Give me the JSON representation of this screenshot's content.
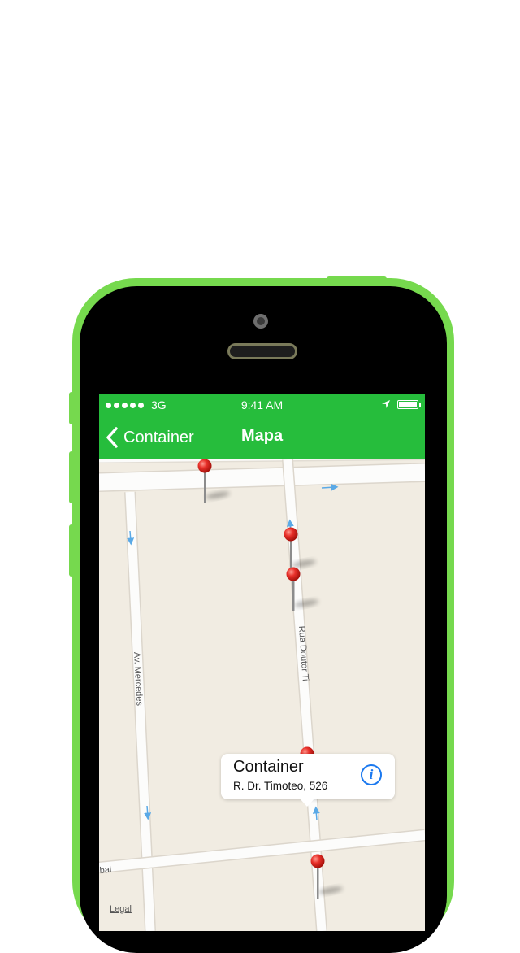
{
  "status_bar": {
    "carrier": "3G",
    "time": "9:41 AM",
    "signal_bars": 5,
    "battery_level": 1.0,
    "location_icon": "location-arrow-icon",
    "battery_icon": "battery-icon"
  },
  "nav_bar": {
    "back_label": "Container",
    "back_icon": "chevron-left-icon",
    "title": "Mapa",
    "color": "#26bd3c"
  },
  "map": {
    "streets": [
      "Av. Mercedes",
      "Rua Doutor Ti",
      "bal"
    ],
    "pin_color": "#e8302a",
    "pin_count": 5,
    "legal_label": "Legal"
  },
  "callout": {
    "title": "Container",
    "subtitle": "R. Dr. Timoteo,  526",
    "info_icon": "info-icon",
    "info_color": "#1a78ef"
  }
}
